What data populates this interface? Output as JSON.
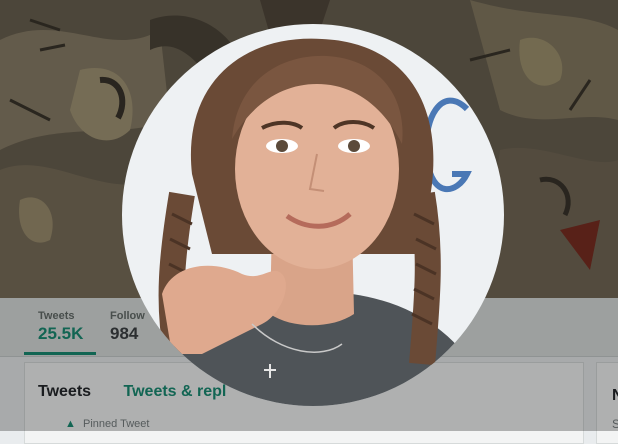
{
  "profile": {
    "avatar_icon": "profile-photo",
    "banner_icon": "banner-illustration"
  },
  "stats": {
    "tweets_label": "Tweets",
    "tweets_value": "25.5K",
    "following_label": "Follow",
    "following_value": "984"
  },
  "timeline": {
    "tab_tweets": "Tweets",
    "tab_replies": "Tweets & repl",
    "pinned_label": "Pinned Tweet"
  },
  "side": {
    "heading": "N",
    "sub": "S"
  },
  "colors": {
    "accent": "#1a8d74",
    "banner": "#5b5446",
    "overlay": "rgba(0,0,0,0.28)"
  }
}
